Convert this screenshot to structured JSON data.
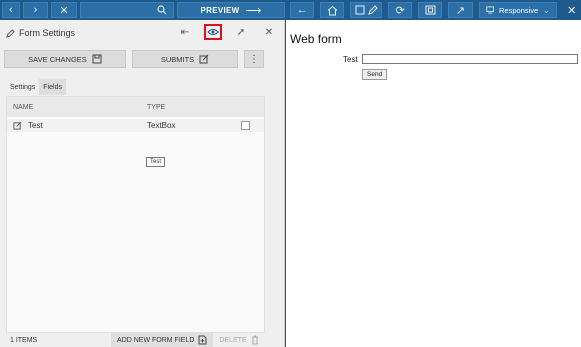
{
  "left_toolbar": {
    "preview_label": "PREVIEW"
  },
  "right_toolbar": {
    "responsive_label": "Responsive"
  },
  "panel": {
    "title": "Form Settings",
    "save_label": "SAVE CHANGES",
    "submits_label": "SUBMITS",
    "tabs": [
      {
        "label": "Settings",
        "active": false
      },
      {
        "label": "Fields",
        "active": true
      }
    ],
    "grid": {
      "columns": [
        "NAME",
        "TYPE"
      ],
      "rows": [
        {
          "name": "Test",
          "type": "TextBox"
        }
      ],
      "tooltip": "Test"
    },
    "footer": {
      "items_count": "1 ITEMS",
      "add_label": "ADD NEW FORM FIELD",
      "delete_label": "DELETE"
    }
  },
  "webform": {
    "title": "Web form",
    "field_label": "Test",
    "field_value": "",
    "send_label": "Send"
  },
  "colors": {
    "toolbar": "#1e5a8c",
    "highlight": "#d9141e"
  }
}
